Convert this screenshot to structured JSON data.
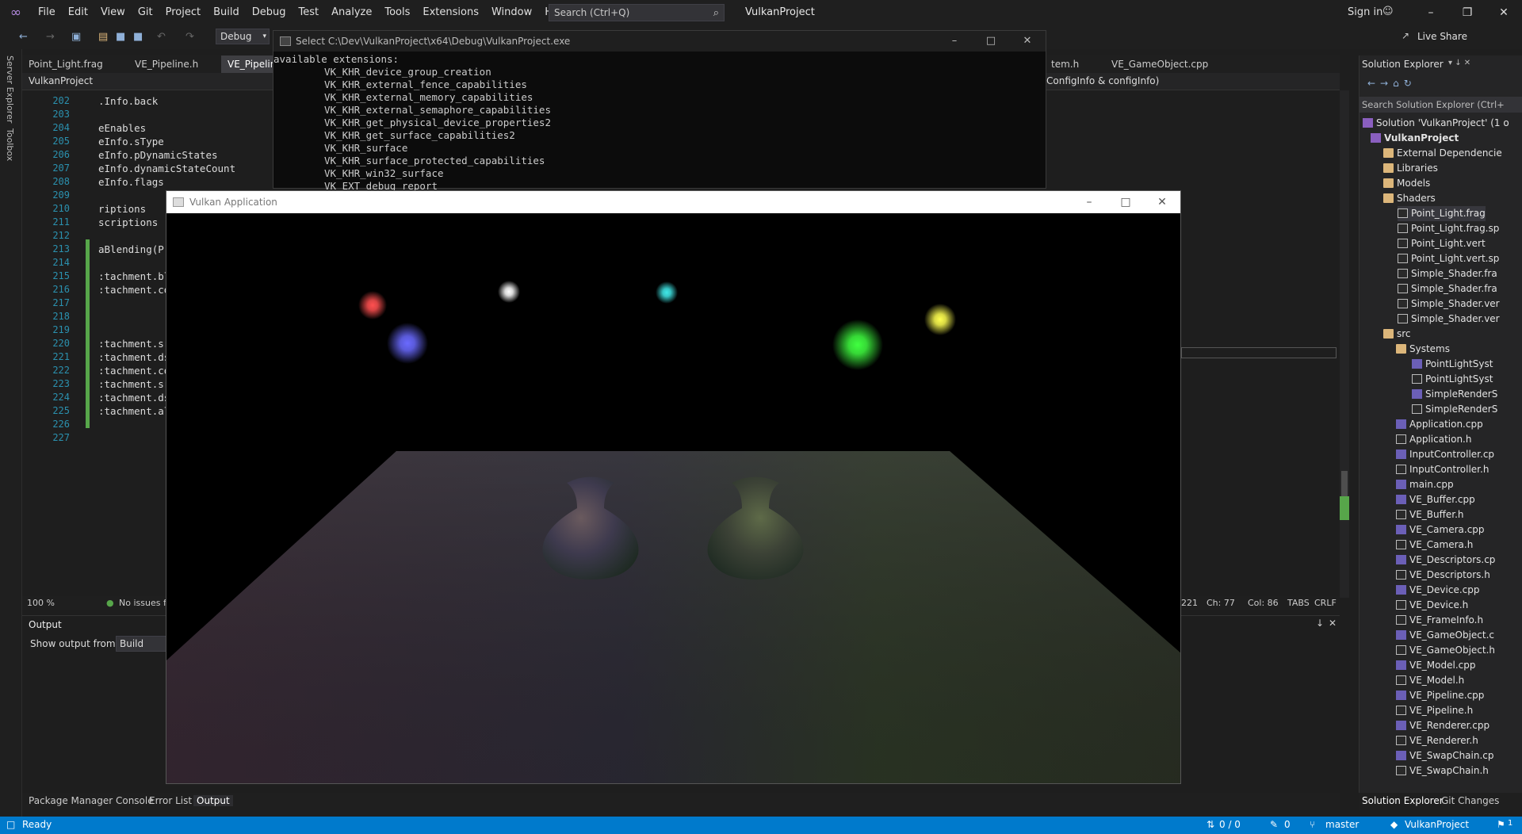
{
  "menu": {
    "items": [
      "File",
      "Edit",
      "View",
      "Git",
      "Project",
      "Build",
      "Debug",
      "Test",
      "Analyze",
      "Tools",
      "Extensions",
      "Window",
      "Help"
    ],
    "search_placeholder": "Search (Ctrl+Q)",
    "project_title": "VulkanProject",
    "signin": "Sign in"
  },
  "toolbar": {
    "config": "Debug",
    "live_share": "Live Share"
  },
  "side_tools": {
    "server_explorer": "Server Explorer",
    "toolbox": "Toolbox"
  },
  "editor": {
    "tabs": [
      "Point_Light.frag",
      "VE_Pipeline.h",
      "VE_Pipelin",
      "tem.h",
      "VE_GameObject.cpp"
    ],
    "project_dropdown": "VulkanProject",
    "member_dropdown": "ConfigInfo & configInfo)",
    "lines": [
      {
        "n": "202",
        "t": ".Info.back"
      },
      {
        "n": "203",
        "t": ""
      },
      {
        "n": "204",
        "t": "eEnables"
      },
      {
        "n": "205",
        "t": "eInfo.sType"
      },
      {
        "n": "206",
        "t": "eInfo.pDynamicStates"
      },
      {
        "n": "207",
        "t": "eInfo.dynamicStateCount"
      },
      {
        "n": "208",
        "t": "eInfo.flags"
      },
      {
        "n": "209",
        "t": ""
      },
      {
        "n": "210",
        "t": "riptions"
      },
      {
        "n": "211",
        "t": "scriptions"
      },
      {
        "n": "212",
        "t": ""
      },
      {
        "n": "213",
        "t": "aBlending(P"
      },
      {
        "n": "214",
        "t": ""
      },
      {
        "n": "215",
        "t": ":tachment.bl"
      },
      {
        "n": "216",
        "t": ":tachment.co"
      },
      {
        "n": "217",
        "t": ""
      },
      {
        "n": "218",
        "t": ""
      },
      {
        "n": "219",
        "t": ""
      },
      {
        "n": "220",
        "t": ":tachment.sr"
      },
      {
        "n": "221",
        "t": ":tachment.ds"
      },
      {
        "n": "222",
        "t": ":tachment.co"
      },
      {
        "n": "223",
        "t": ":tachment.sr"
      },
      {
        "n": "224",
        "t": ":tachment.ds"
      },
      {
        "n": "225",
        "t": ":tachment.al"
      },
      {
        "n": "226",
        "t": ""
      },
      {
        "n": "227",
        "t": ""
      }
    ],
    "status": {
      "zoom": "100 %",
      "issues": "No issues f",
      "ln": "221",
      "ch": "Ch: 77",
      "col": "Col: 86",
      "tabs": "TABS",
      "eol": "CRLF"
    }
  },
  "output": {
    "title": "Output",
    "show_from_label": "Show output from:",
    "source": "Build"
  },
  "bottom_tabs": [
    "Package Manager Console",
    "Error List",
    "Output"
  ],
  "console": {
    "title": "Select C:\\Dev\\VulkanProject\\x64\\Debug\\VulkanProject.exe",
    "header": "available extensions:",
    "extensions": [
      "VK_KHR_device_group_creation",
      "VK_KHR_external_fence_capabilities",
      "VK_KHR_external_memory_capabilities",
      "VK_KHR_external_semaphore_capabilities",
      "VK_KHR_get_physical_device_properties2",
      "VK_KHR_get_surface_capabilities2",
      "VK_KHR_surface",
      "VK_KHR_surface_protected_capabilities",
      "VK_KHR_win32_surface",
      "VK_EXT_debug_report"
    ]
  },
  "vulkan_window": {
    "title": "Vulkan Application",
    "lights": [
      {
        "color": "#ff5050"
      },
      {
        "color": "#6a6aff"
      },
      {
        "color": "#ffffff"
      },
      {
        "color": "#40e8e8"
      },
      {
        "color": "#40ff40"
      },
      {
        "color": "#ffff50"
      }
    ]
  },
  "solution_explorer": {
    "title": "Solution Explorer",
    "search_placeholder": "Search Solution Explorer (Ctrl+",
    "items": [
      {
        "label": "Solution 'VulkanProject' (1 o",
        "icon": "solution"
      },
      {
        "label": "VulkanProject",
        "icon": "project"
      },
      {
        "label": "External Dependencie",
        "icon": "folder"
      },
      {
        "label": "Libraries",
        "icon": "folder"
      },
      {
        "label": "Models",
        "icon": "folder"
      },
      {
        "label": "Shaders",
        "icon": "folder"
      },
      {
        "label": "Point_Light.frag",
        "icon": "file"
      },
      {
        "label": "Point_Light.frag.sp",
        "icon": "file"
      },
      {
        "label": "Point_Light.vert",
        "icon": "file"
      },
      {
        "label": "Point_Light.vert.sp",
        "icon": "file"
      },
      {
        "label": "Simple_Shader.fra",
        "icon": "file"
      },
      {
        "label": "Simple_Shader.fra",
        "icon": "file"
      },
      {
        "label": "Simple_Shader.ver",
        "icon": "file"
      },
      {
        "label": "Simple_Shader.ver",
        "icon": "file"
      },
      {
        "label": "src",
        "icon": "folder"
      },
      {
        "label": "Systems",
        "icon": "folder"
      },
      {
        "label": "PointLightSyst",
        "icon": "cpp"
      },
      {
        "label": "PointLightSyst",
        "icon": "file"
      },
      {
        "label": "SimpleRenderS",
        "icon": "cpp"
      },
      {
        "label": "SimpleRenderS",
        "icon": "file"
      },
      {
        "label": "Application.cpp",
        "icon": "cpp"
      },
      {
        "label": "Application.h",
        "icon": "file"
      },
      {
        "label": "InputController.cp",
        "icon": "cpp"
      },
      {
        "label": "InputController.h",
        "icon": "file"
      },
      {
        "label": "main.cpp",
        "icon": "cpp"
      },
      {
        "label": "VE_Buffer.cpp",
        "icon": "cpp"
      },
      {
        "label": "VE_Buffer.h",
        "icon": "file"
      },
      {
        "label": "VE_Camera.cpp",
        "icon": "cpp"
      },
      {
        "label": "VE_Camera.h",
        "icon": "file"
      },
      {
        "label": "VE_Descriptors.cp",
        "icon": "cpp"
      },
      {
        "label": "VE_Descriptors.h",
        "icon": "file"
      },
      {
        "label": "VE_Device.cpp",
        "icon": "cpp"
      },
      {
        "label": "VE_Device.h",
        "icon": "file"
      },
      {
        "label": "VE_FrameInfo.h",
        "icon": "file"
      },
      {
        "label": "VE_GameObject.c",
        "icon": "cpp"
      },
      {
        "label": "VE_GameObject.h",
        "icon": "file"
      },
      {
        "label": "VE_Model.cpp",
        "icon": "cpp"
      },
      {
        "label": "VE_Model.h",
        "icon": "file"
      },
      {
        "label": "VE_Pipeline.cpp",
        "icon": "cpp"
      },
      {
        "label": "VE_Pipeline.h",
        "icon": "file"
      },
      {
        "label": "VE_Renderer.cpp",
        "icon": "cpp"
      },
      {
        "label": "VE_Renderer.h",
        "icon": "file"
      },
      {
        "label": "VE_SwapChain.cp",
        "icon": "cpp"
      },
      {
        "label": "VE_SwapChain.h",
        "icon": "file"
      }
    ],
    "tabs": [
      "Solution Explorer",
      "Git Changes"
    ]
  },
  "status_bar": {
    "ready": "Ready",
    "updown": "0 / 0",
    "pencil": "0",
    "branch": "master",
    "repo": "VulkanProject",
    "notifications": "1"
  }
}
